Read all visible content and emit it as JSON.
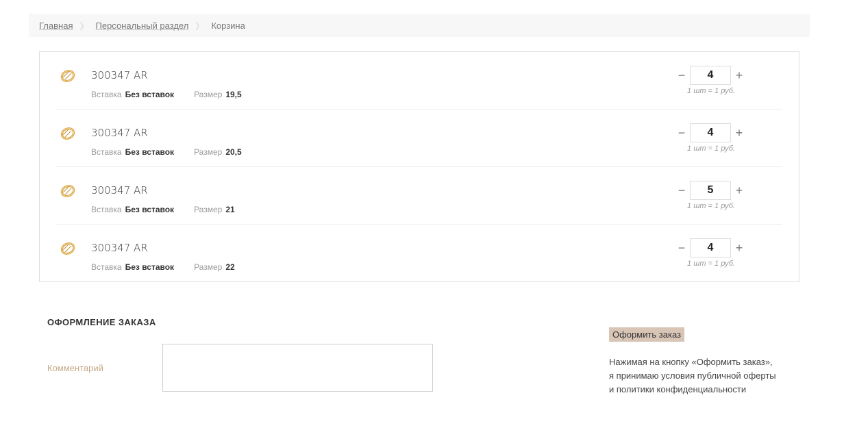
{
  "breadcrumb": {
    "items": [
      {
        "label": "Главная"
      },
      {
        "label": "Персональный раздел"
      }
    ],
    "separator": "〉",
    "current": "Корзина"
  },
  "cart": {
    "items": [
      {
        "name": "300347 AR",
        "insert_label": "Вставка",
        "insert_value": "Без вставок",
        "size_label": "Размер",
        "size_value": "19,5",
        "quantity": "4",
        "minus": "−",
        "plus": "+",
        "unit_price": "1 шт = 1 руб."
      },
      {
        "name": "300347 AR",
        "insert_label": "Вставка",
        "insert_value": "Без вставок",
        "size_label": "Размер",
        "size_value": "20,5",
        "quantity": "4",
        "minus": "−",
        "plus": "+",
        "unit_price": "1 шт = 1 руб."
      },
      {
        "name": "300347 AR",
        "insert_label": "Вставка",
        "insert_value": "Без вставок",
        "size_label": "Размер",
        "size_value": "21",
        "quantity": "5",
        "minus": "−",
        "plus": "+",
        "unit_price": "1 шт = 1 руб."
      },
      {
        "name": "300347 AR",
        "insert_label": "Вставка",
        "insert_value": "Без вставок",
        "size_label": "Размер",
        "size_value": "22",
        "quantity": "4",
        "minus": "−",
        "plus": "+",
        "unit_price": "1 шт = 1 руб."
      }
    ]
  },
  "checkout": {
    "title": "ОФОРМЛЕНИЕ ЗАКАЗА",
    "comment_label": "Комментарий",
    "comment_value": "",
    "order_button": "Оформить заказ",
    "disclaimer_lines": [
      "Нажимая на кнопку «Оформить заказ»,",
      "я принимаю условия публичной оферты",
      "и политики конфиденциальности"
    ]
  },
  "colors": {
    "accent_button": "#d8c5b6",
    "comment_label": "#c8a888",
    "ring_gold": "#d9a441"
  },
  "icons": {
    "item_thumbnail": "gold-ring-icon"
  }
}
